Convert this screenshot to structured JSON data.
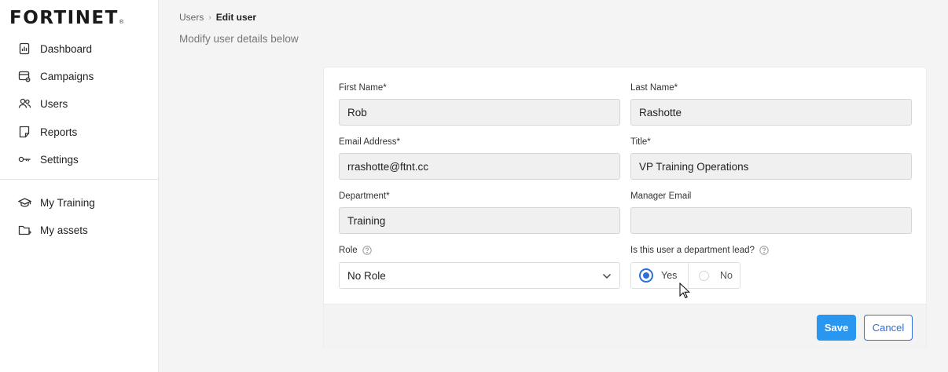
{
  "brand": {
    "logo_text": "FORTINET",
    "logo_mark": "®"
  },
  "sidebar": {
    "items": [
      {
        "label": "Dashboard",
        "icon": "dashboard-icon"
      },
      {
        "label": "Campaigns",
        "icon": "campaigns-icon"
      },
      {
        "label": "Users",
        "icon": "users-icon"
      },
      {
        "label": "Reports",
        "icon": "reports-icon"
      },
      {
        "label": "Settings",
        "icon": "key-icon"
      },
      {
        "label": "My Training",
        "icon": "graduation-cap-icon"
      },
      {
        "label": "My assets",
        "icon": "folder-icon"
      }
    ]
  },
  "header": {
    "breadcrumb": [
      "Users",
      "Edit user"
    ],
    "subtitle": "Modify user details below"
  },
  "form": {
    "first_name": {
      "label": "First Name*",
      "value": "Rob"
    },
    "last_name": {
      "label": "Last Name*",
      "value": "Rashotte"
    },
    "email": {
      "label": "Email Address*",
      "value": "rrashotte@ftnt.cc"
    },
    "title": {
      "label": "Title*",
      "value": "VP Training Operations"
    },
    "department": {
      "label": "Department*",
      "value": "Training"
    },
    "manager_email": {
      "label": "Manager Email",
      "value": ""
    },
    "role": {
      "label": "Role",
      "value": "No Role"
    },
    "department_lead": {
      "label": "Is this user a department lead?",
      "options": [
        "Yes",
        "No"
      ],
      "selected": "Yes"
    }
  },
  "actions": {
    "save": "Save",
    "cancel": "Cancel"
  },
  "colors": {
    "primary": "#2996f0",
    "radio_accent": "#2f6fd6"
  }
}
